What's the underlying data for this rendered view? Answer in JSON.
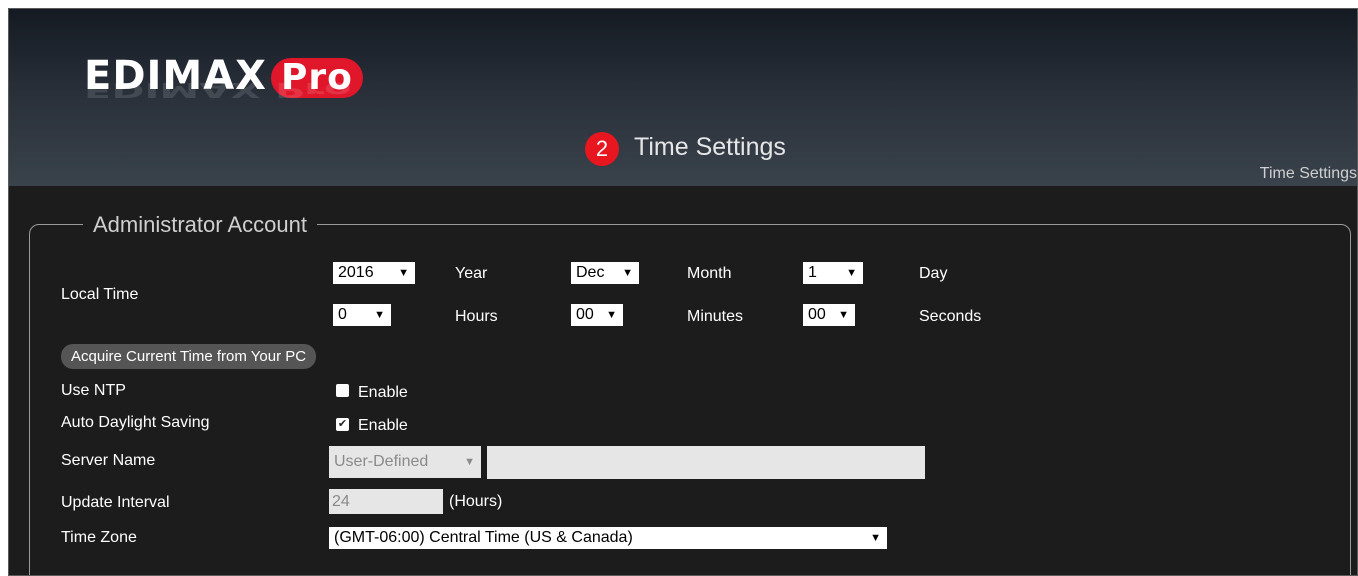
{
  "header": {
    "logo_main": "EDIMAX",
    "logo_pro": "Pro",
    "step_number": "2",
    "page_title": "Time Settings",
    "breadcrumb": "Time Settings"
  },
  "section": {
    "legend": "Administrator Account"
  },
  "local_time": {
    "label": "Local Time",
    "year_value": "2016",
    "year_label": "Year",
    "month_value": "Dec",
    "month_label": "Month",
    "day_value": "1",
    "day_label": "Day",
    "hour_value": "0",
    "hours_label": "Hours",
    "minute_value": "00",
    "minutes_label": "Minutes",
    "second_value": "00",
    "seconds_label": "Seconds",
    "acquire_button": "Acquire Current Time from Your PC"
  },
  "ntp": {
    "label": "Use NTP",
    "enable_label": "Enable",
    "checked": false
  },
  "dst": {
    "label": "Auto Daylight Saving",
    "enable_label": "Enable",
    "checked": true
  },
  "server": {
    "label": "Server Name",
    "select_value": "User-Defined",
    "input_value": ""
  },
  "interval": {
    "label": "Update Interval",
    "value": "24",
    "unit": "(Hours)"
  },
  "timezone": {
    "label": "Time Zone",
    "value": "(GMT-06:00) Central Time (US & Canada)"
  },
  "icons": {
    "dropdown_arrow": "▼",
    "checkmark": "✔"
  }
}
